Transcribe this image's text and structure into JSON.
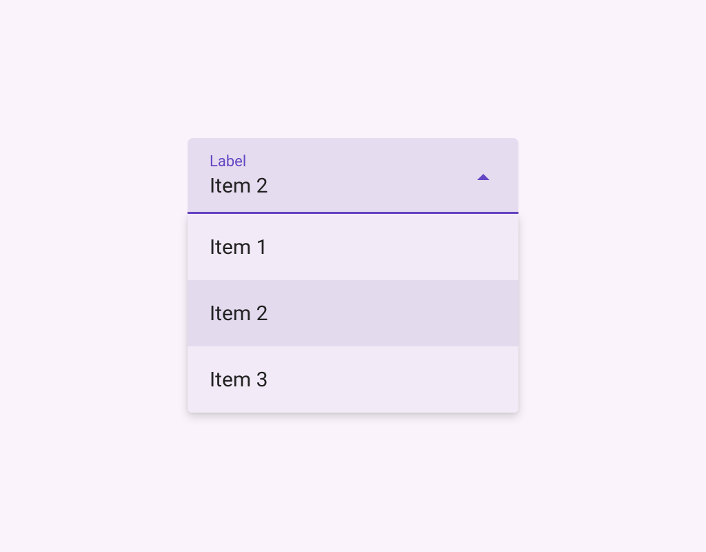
{
  "select": {
    "label": "Label",
    "value": "Item 2",
    "options": [
      {
        "label": "Item 1",
        "selected": false
      },
      {
        "label": "Item 2",
        "selected": true
      },
      {
        "label": "Item 3",
        "selected": false
      }
    ]
  }
}
